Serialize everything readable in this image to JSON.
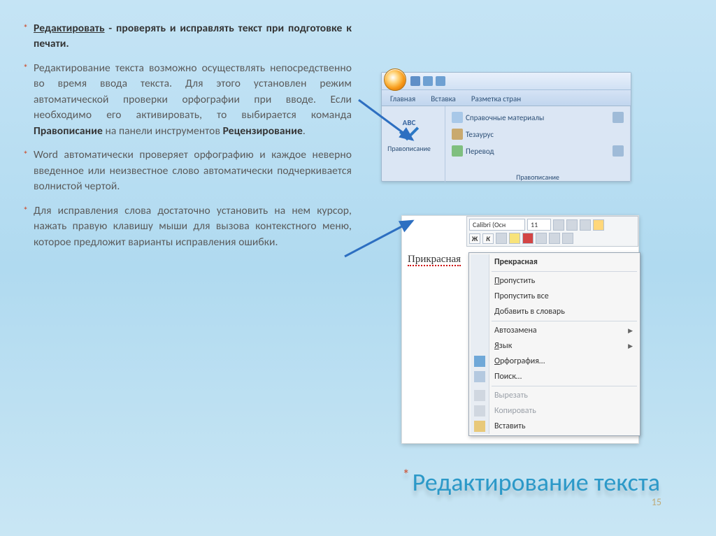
{
  "bullets": {
    "b1_lead": "Редактировать",
    "b1_rest": " - проверять и исправлять текст при подготовке к печати.",
    "b2_a": "Редактирование текста возможно  осуществлять непосредственно во время ввода текста. Для этого установлен режим автоматической проверки орфографии при вводе. Если необходимо его активировать, то выбирается команда ",
    "b2_b": "Правописание",
    "b2_c": " на панели инструментов ",
    "b2_d": "Рецензирование",
    "b2_e": ".",
    "b3": "Word автоматически проверяет орфографию и каждое неверно введенное или неизвестное слово автоматически подчеркивается волнистой чертой.",
    "b4": "Для исправления слова достаточно установить на нем курсор, нажать правую клавишу мыши для вызова контекстного меню, которое предложит варианты исправления ошибки."
  },
  "slide_title": "Редактирование текста",
  "page_number": "15",
  "ribbon": {
    "tabs": {
      "home": "Главная",
      "insert": "Вставка",
      "layout": "Разметка стран"
    },
    "abc": "ABC",
    "spelling_btn": "Правописание",
    "ref_materials": "Справочные материалы",
    "thesaurus": "Тезаурус",
    "translate": "Перевод",
    "group_label": "Правописание"
  },
  "spell": {
    "font_name": "Calibri (Осн",
    "font_size": "11",
    "typed_word": "Прикрасная",
    "suggestion": "Прекрасная",
    "skip": "Пропустить",
    "skip_all": "Пропустить все",
    "add_dict": "обавить в словарь",
    "autocorrect": "Автозамена",
    "language": "зык",
    "spelling": "рфография…",
    "find": "Поиск…",
    "cut": "Вырезать",
    "copy": "Копировать",
    "paste": "Вставить"
  }
}
